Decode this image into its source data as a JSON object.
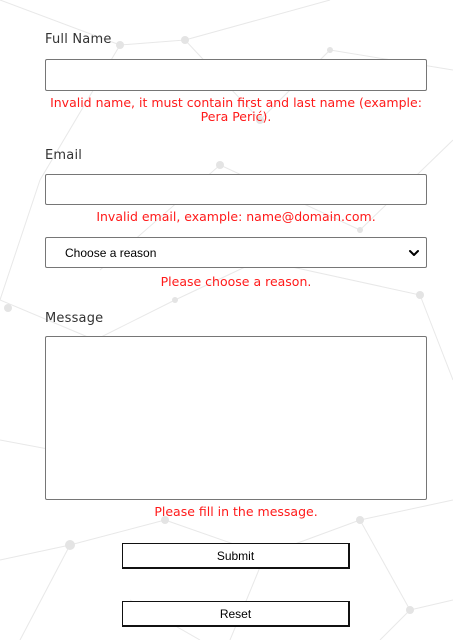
{
  "form": {
    "full_name": {
      "label": "Full Name",
      "value": "",
      "error": "Invalid name, it must contain first and last name (example: Pera Perić)."
    },
    "email": {
      "label": "Email",
      "value": "",
      "error": "Invalid email, example: name@domain.com."
    },
    "reason": {
      "selected": "Choose a reason",
      "error": "Please choose a reason."
    },
    "message": {
      "label": "Message",
      "value": "",
      "error": "Please fill in the message."
    },
    "submit_label": "Submit",
    "reset_label": "Reset"
  },
  "icons": {
    "select_arrow": "chevron-down-icon"
  },
  "colors": {
    "error": "#ff1a1a",
    "border": "#767676",
    "background_pattern": "#e6e6e6"
  }
}
